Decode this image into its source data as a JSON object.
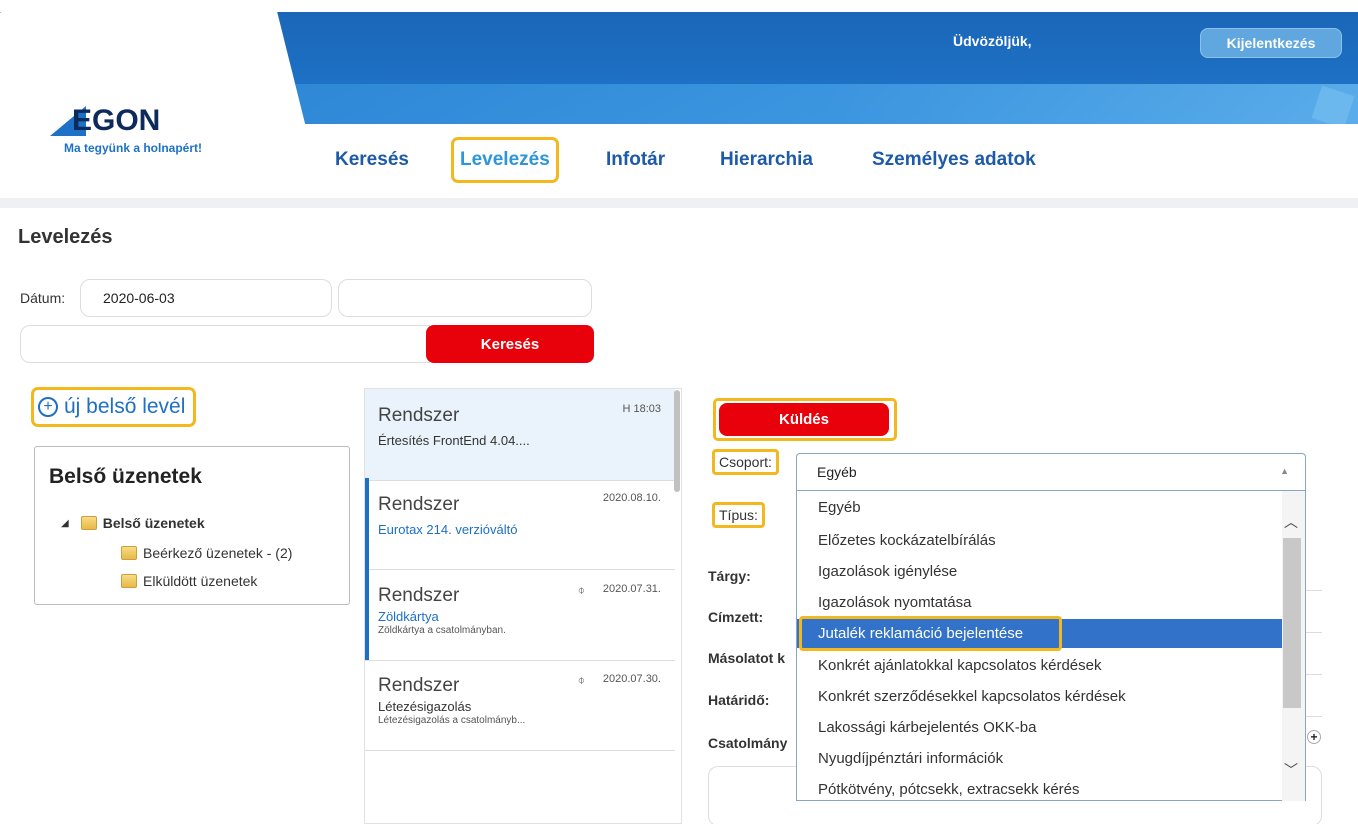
{
  "header": {
    "logo_text": "EGON",
    "tagline": "Ma tegyünk a holnapért!",
    "welcome": "Üdvözöljük,",
    "logout": "Kijelentkezés"
  },
  "nav": {
    "items": [
      "Keresés",
      "Levelezés",
      "Infotár",
      "Hierarchia",
      "Személyes adatok"
    ],
    "active": "Levelezés"
  },
  "page": {
    "title": "Levelezés",
    "date_label": "Dátum:",
    "date_value": "2020-06-03",
    "search_button": "Keresés",
    "new_letter": "új belső levél"
  },
  "tree": {
    "title": "Belső üzenetek",
    "root": "Belső üzenetek",
    "children": [
      "Beérkező üzenetek - (2)",
      "Elküldött üzenetek"
    ]
  },
  "messages": [
    {
      "from": "Rendszer",
      "date": "H 18:03",
      "subject": "Értesítés FrontEnd 4.04....",
      "preview": "",
      "attachment": false
    },
    {
      "from": "Rendszer",
      "date": "2020.08.10.",
      "subject": "Eurotax 214. verzióváltó",
      "preview": "",
      "attachment": false
    },
    {
      "from": "Rendszer",
      "date": "2020.07.31.",
      "subject": "Zöldkártya",
      "preview": "Zöldkártya a csatolmányban.",
      "attachment": true
    },
    {
      "from": "Rendszer",
      "date": "2020.07.30.",
      "subject": "Létezésigazolás",
      "preview": "Létezésigazolás a csatolmányb...",
      "attachment": true
    }
  ],
  "form": {
    "send": "Küldés",
    "group_label": "Csoport:",
    "type_label": "Típus:",
    "subject_label": "Tárgy:",
    "recipient_label": "Címzett:",
    "cc_label": "Másolatot k",
    "deadline_label": "Határidő:",
    "attachment_label": "Csatolmány",
    "group_selected": "Egyéb",
    "options": [
      "Egyéb",
      "Előzetes kockázatelbírálás",
      "Igazolások igénylése",
      "Igazolások nyomtatása",
      "Jutalék reklamáció bejelentése",
      "Konkrét ajánlatokkal kapcsolatos kérdések",
      "Konkrét szerződésekkel kapcsolatos kérdések",
      "Lakossági kárbejelentés OKK-ba",
      "Nyugdíjpénztári információk",
      "Pótkötvény, pótcsekk, extracsekk kérés"
    ],
    "highlighted_option": "Jutalék reklamáció bejelentése"
  },
  "colors": {
    "brand": "#1d70c4",
    "accent": "#e8000a",
    "highlight": "#f3b81d"
  }
}
